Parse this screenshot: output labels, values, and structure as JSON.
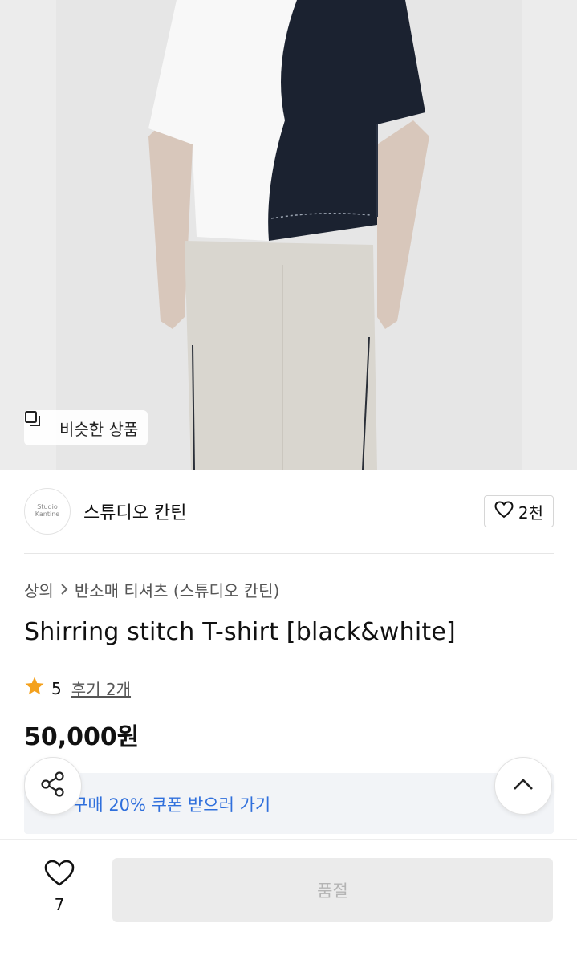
{
  "image": {
    "similar_button_label": "비슷한 상품"
  },
  "brand": {
    "logo_text_top": "Studio",
    "logo_text_bottom": "Kantine",
    "name": "스튜디오 칸틴",
    "likes": "2천"
  },
  "breadcrumb": {
    "category": "상의",
    "subcategory": "반소매 티셔츠 (스튜디오 칸틴)"
  },
  "product": {
    "title": "Shirring stitch T-shirt [black&white]",
    "rating": "5",
    "reviews": "후기 2개",
    "price": "50,000원"
  },
  "coupon": {
    "text": "구매 20% 쿠폰 받으러 가기"
  },
  "bottom_bar": {
    "wish_count": "7",
    "action_label": "품절"
  },
  "colors": {
    "accent_blue": "#2f6fdc",
    "star": "#f4a11d",
    "disabled_bg": "#ebebeb"
  },
  "icons": [
    "copy-icon",
    "heart-icon",
    "chevron-right-icon",
    "star-icon",
    "share-icon",
    "chevron-up-icon"
  ]
}
